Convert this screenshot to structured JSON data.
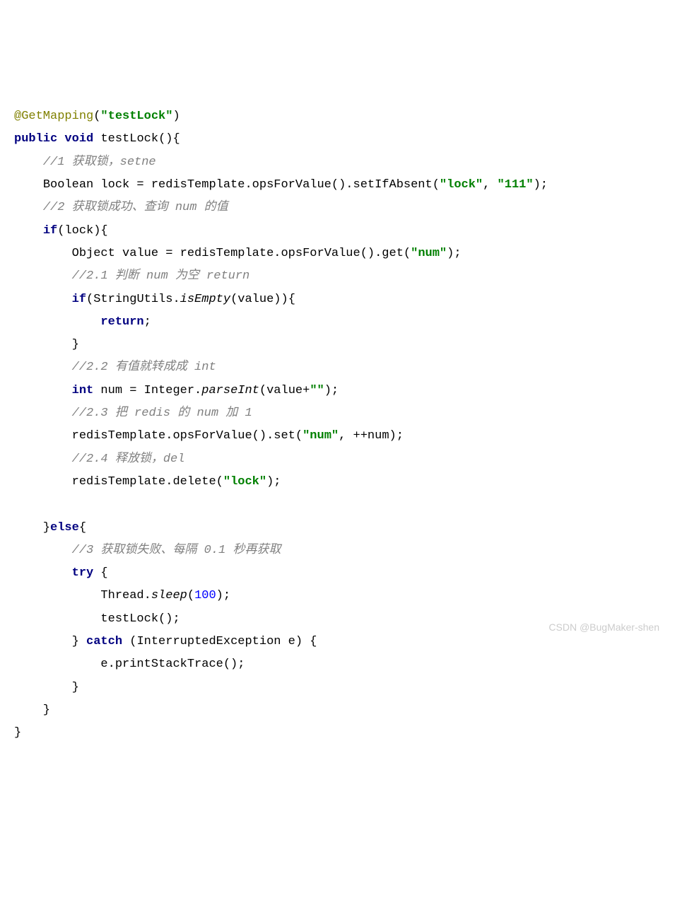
{
  "code": {
    "annotation_name": "@GetMapping",
    "annotation_value": "\"testLock\"",
    "signature_kw1": "public",
    "signature_kw2": "void",
    "method_name": "testLock",
    "comment1": "//1 获取锁，setne",
    "line_lock_type": "Boolean lock = ",
    "redisTemplate": "redisTemplate",
    "opsForValue_call": ".opsForValue().setIfAbsent(",
    "str_lock": "\"lock\"",
    "str_111": "\"111\"",
    "comment2": "//2 获取锁成功、查询 num 的值",
    "kw_if": "if",
    "if_cond": "(lock){",
    "line_get_pre": "Object value = ",
    "ops_get": ".opsForValue().get(",
    "str_num": "\"num\"",
    "comment21": "//2.1 判断 num 为空 return",
    "stringutils": "(StringUtils.",
    "isEmpty": "isEmpty",
    "isEmpty_tail": "(value)){",
    "kw_return": "return",
    "comment22": "//2.2 有值就转成成 int",
    "kw_int": "int",
    "parseInt_pre": " num = Integer.",
    "parseInt": "parseInt",
    "parseInt_tail": "(value+",
    "empty_str": "\"\"",
    "comment23": "//2.3 把 redis 的 num 加 1",
    "ops_set": ".opsForValue().set(",
    "set_tail": ", ++num);",
    "comment24": "//2.4 释放锁，del",
    "delete_pre": ".delete(",
    "kw_else": "else",
    "comment3": "//3 获取锁失败、每隔 0.1 秒再获取",
    "kw_try": "try",
    "thread_sleep_pre": "Thread.",
    "sleep": "sleep",
    "num_100": "100",
    "testLock_call": "testLock();",
    "kw_catch": "catch",
    "catch_param": " (InterruptedException e) {",
    "printStack": "e.printStackTrace();"
  },
  "watermark": "CSDN @BugMaker-shen"
}
